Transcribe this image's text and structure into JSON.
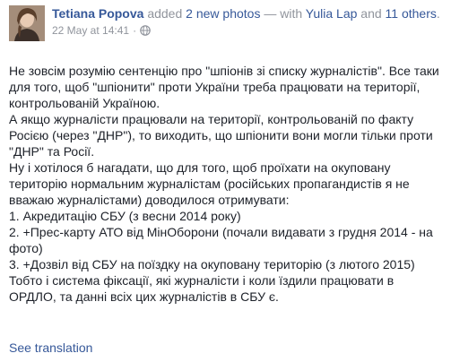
{
  "post": {
    "author": "Tetiana Popova",
    "action": "added",
    "photos_link": "2 new photos",
    "with_text": "— with",
    "tagged_person": "Yulia Lap",
    "and_text": "and",
    "others_link": "11 others",
    "period": ".",
    "timestamp": "22 May at 14:41",
    "separator": "·",
    "privacy_icon": "globe-icon",
    "paragraphs": [
      "Не зовсім розумію сентенцію про \"шпіонів зі списку журналістів\". Все таки для того, щоб \"шпіонити\" проти України треба працювати на території, контрольованій Україною.",
      "А якщо журналісти працювали на території, контрольованій по факту Росією (через \"ДНР\"), то виходить, що шпіонити вони могли тільки проти \"ДНР\" та Росії.",
      "Ну і хотілося б нагадати, що для того, щоб проїхати на окуповану територію нормальним журналістам (російських пропагандистів я не вважаю журналістами) доводилося отримувати:",
      "1. Акредитацію СБУ (з весни 2014 року)",
      "2. +Прес-карту АТО від МінОборони (почали видавати з грудня 2014 - на фото)",
      "3. +Дозвіл від СБУ на поїздку на окуповану територію (з лютого 2015)",
      "Тобто і система фіксації, які журналісти і коли їздили працювати в ОРДЛО, та данні всіх цих журналістів в СБУ є."
    ],
    "see_translation": "See translation"
  },
  "colors": {
    "link": "#365899",
    "meta": "#90949c",
    "text": "#1d2129",
    "background": "#ffffff"
  }
}
